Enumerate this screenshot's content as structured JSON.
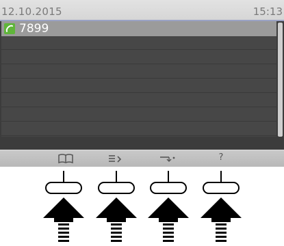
{
  "status_bar": {
    "date": "12.10.2015",
    "time": "15:13"
  },
  "call_list": {
    "items": [
      {
        "icon": "phone-handset-icon",
        "number": "7899",
        "selected": true
      }
    ]
  },
  "softkeys": [
    {
      "icon": "phonebook-icon"
    },
    {
      "icon": "menu-list-icon"
    },
    {
      "icon": "call-forward-icon"
    },
    {
      "label": "?",
      "icon": "help-icon"
    }
  ],
  "colors": {
    "screen_background": "#3c3c3c",
    "status_bar": "#d9d9d9",
    "selected_row": "#9b9b9b",
    "call_icon": "#5fb53a",
    "softkey_bar": "#c2c2c2"
  }
}
